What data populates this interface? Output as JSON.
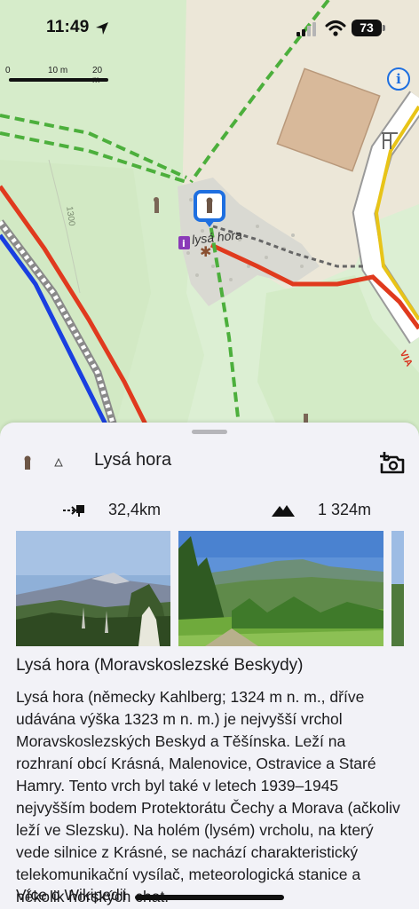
{
  "status_bar": {
    "time": "11:49",
    "battery": "73"
  },
  "map": {
    "scale_labels": [
      "0",
      "10 m",
      "20 m"
    ],
    "peak_label": "lysá hora",
    "road_label": "VIA",
    "contour_label": "1300",
    "info_button_label": "i"
  },
  "sheet": {
    "title": "Lysá hora",
    "distance": "32,4km",
    "elevation": "1 324m",
    "photos": [
      {
        "name": "photo-peak-from-valley"
      },
      {
        "name": "photo-ridge-meadow"
      },
      {
        "name": "photo-partial"
      }
    ]
  },
  "article": {
    "title": "Lysá hora (Moravskoslezské Beskydy)",
    "text": "Lysá hora (německy Kahlberg; 1324 m n. m., dříve udávána výška 1323 m n. m.) je nejvyšší vrchol Moravskoslezských Beskyd a Těšínska. Leží na rozhraní obcí Krásná, Malenovice, Ostravice a Staré Hamry. Tento vrch byl také v letech 1939–1945 nejvyšším bodem Protektorátu Čechy a Morava (ačkoliv leží ve Slezsku). Na holém (lysém) vrcholu, na který vede silnice z Krásné, se nachází charakteristický telekomunikační vysílač, meteorologická stanice a několik horských chat.",
    "more": "Více o Wikipedii"
  },
  "colors": {
    "accent": "#1e6fe0",
    "trail_red": "#e03a1e",
    "trail_green": "#4caf3c",
    "trail_blue": "#1a3fe0",
    "road_yellow": "#e8c418",
    "sheet_bg": "#f2f2f7"
  },
  "icons": [
    "location-arrow-icon",
    "signal-icon",
    "wifi-icon",
    "info-icon",
    "peak-icon",
    "triangle-icon",
    "add-photo-icon",
    "distance-icon",
    "mountain-icon"
  ]
}
